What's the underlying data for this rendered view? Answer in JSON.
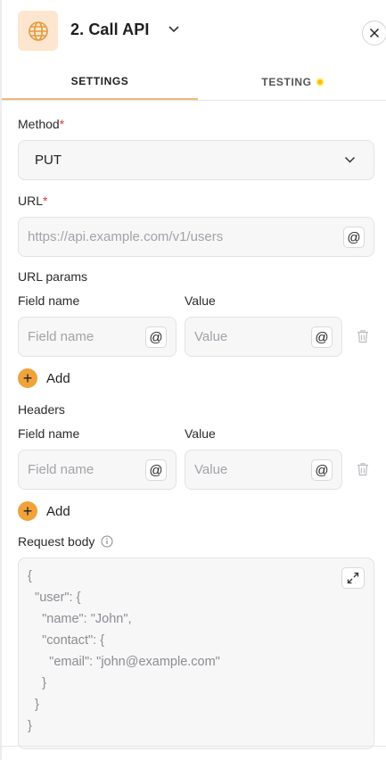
{
  "header": {
    "title": "2.  Call API",
    "icon": "globe-icon",
    "accent": "#fde6cf"
  },
  "tabs": [
    {
      "label": "SETTINGS",
      "active": true
    },
    {
      "label": "TESTING",
      "status_color": "#f5c400"
    }
  ],
  "method": {
    "label": "Method",
    "required_mark": "*",
    "value": "PUT"
  },
  "url": {
    "label": "URL",
    "required_mark": "*",
    "placeholder": "https://api.example.com/v1/users",
    "at": "@"
  },
  "url_params": {
    "label": "URL params",
    "field_col": "Field name",
    "value_col": "Value",
    "field_placeholder": "Field name",
    "value_placeholder": "Value",
    "at": "@",
    "add_label": "Add"
  },
  "headers": {
    "label": "Headers",
    "field_col": "Field name",
    "value_col": "Value",
    "field_placeholder": "Field name",
    "value_placeholder": "Value",
    "at": "@",
    "add_label": "Add"
  },
  "request_body": {
    "label": "Request body",
    "lines": [
      "{",
      "  \"user\": {",
      "    \"name\": \"John\",",
      "    \"contact\": {",
      "      \"email\": \"john@example.com\"",
      "    }",
      "  }",
      "}"
    ]
  },
  "colors": {
    "add_button": "#f0a33a",
    "required": "#d93b3b",
    "tab_underline": "#f0b97a"
  }
}
